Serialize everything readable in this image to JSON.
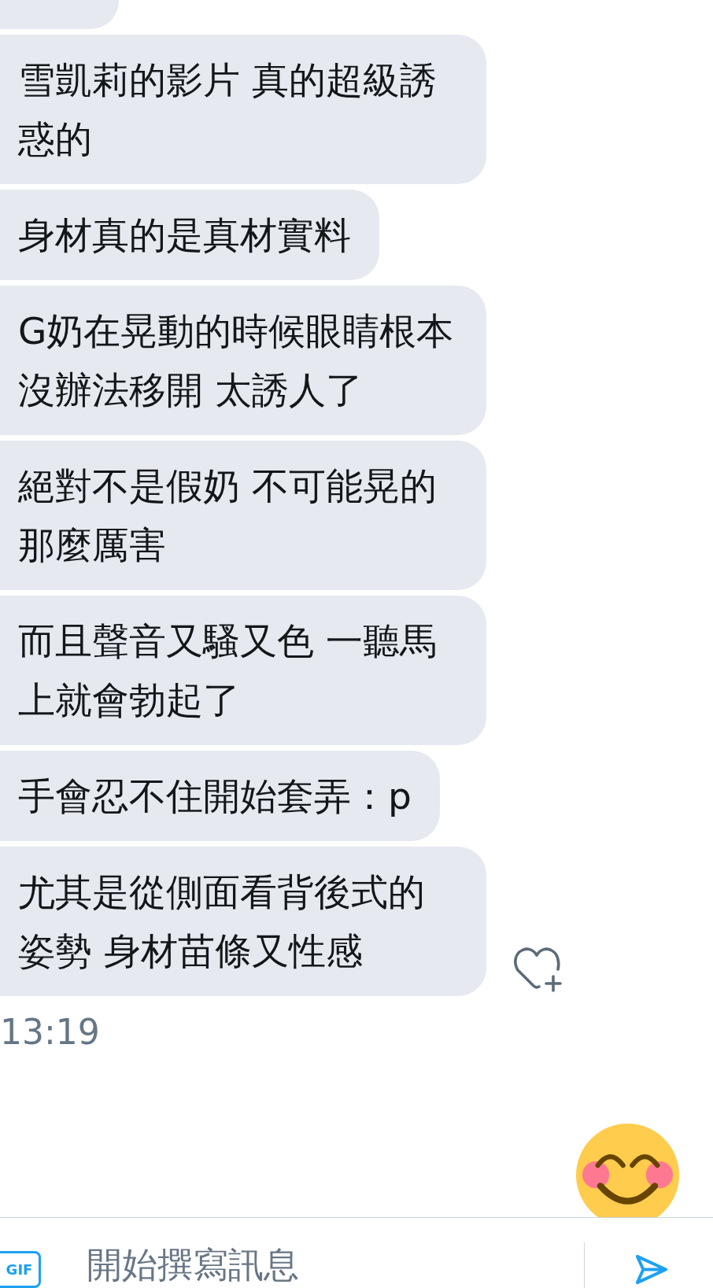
{
  "messages": [
    {
      "kind": "partial"
    },
    {
      "kind": "text",
      "text": "雪凱莉的影片 真的超級誘惑的"
    },
    {
      "kind": "text",
      "text": "身材真的是真材實料"
    },
    {
      "kind": "text",
      "text": "G奶在晃動的時候眼睛根本沒辦法移開 太誘人了"
    },
    {
      "kind": "text",
      "text": "絕對不是假奶 不可能晃的那麼厲害"
    },
    {
      "kind": "text",
      "text": "而且聲音又騷又色 一聽馬上就會勃起了"
    },
    {
      "kind": "text",
      "text": "手會忍不住開始套弄：p"
    },
    {
      "kind": "text",
      "text": "尤其是從側面看背後式的姿勢 身材苗條又性感"
    }
  ],
  "timestamp": "13:19",
  "composer": {
    "gif_label": "GIF",
    "placeholder": "開始撰寫訊息"
  }
}
